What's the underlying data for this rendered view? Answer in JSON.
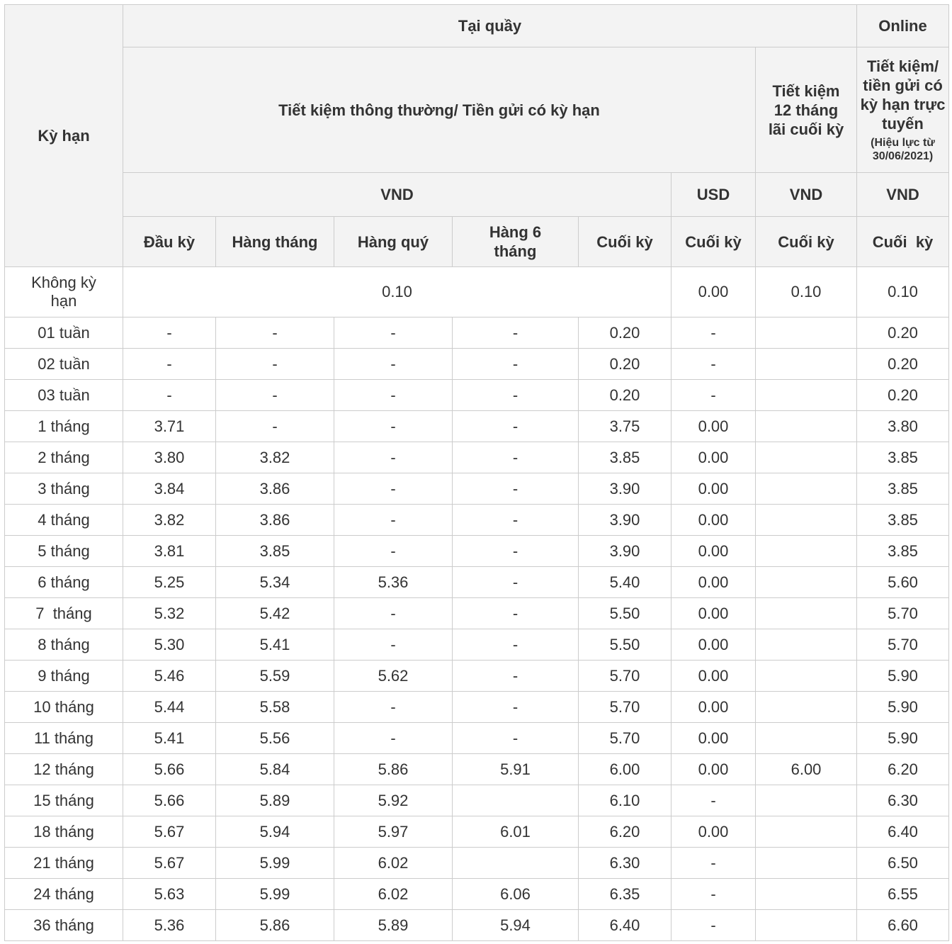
{
  "header": {
    "term_label": "Kỳ hạn",
    "counter_label": "Tại quầy",
    "online_label": "Online",
    "regular_savings_label": "Tiết kiệm thông thường/ Tiền gửi có kỳ hạn",
    "savings_12m_label": "Tiết kiệm 12 tháng lãi cuối kỳ",
    "online_savings_label": "Tiết kiệm/ tiền gửi có kỳ hạn trực tuyến",
    "online_effective_note": "(Hiệu lực từ 30/06/2021)",
    "currency": {
      "regular_vnd": "VND",
      "regular_usd": "USD",
      "savings_12m_vnd": "VND",
      "online_vnd": "VND"
    },
    "payment": {
      "beginning": "Đầu kỳ",
      "monthly": "Hàng tháng",
      "quarterly": "Hàng quý",
      "six_monthly": "Hàng 6 tháng",
      "end_vnd": "Cuối kỳ",
      "end_usd": "Cuối kỳ",
      "end_12m": "Cuối kỳ",
      "end_online": "Cuối  kỳ"
    }
  },
  "no_term_row": {
    "term": "Không kỳ hạn",
    "vnd": "0.10",
    "usd": "0.00",
    "savings_12m": "0.10",
    "online": "0.10"
  },
  "rows": [
    {
      "term": "01 tuần",
      "vals": [
        "-",
        "-",
        "-",
        "-",
        "0.20",
        "-",
        "",
        "0.20"
      ]
    },
    {
      "term": "02 tuần",
      "vals": [
        "-",
        "-",
        "-",
        "-",
        "0.20",
        "-",
        "",
        "0.20"
      ]
    },
    {
      "term": "03 tuần",
      "vals": [
        "-",
        "-",
        "-",
        "-",
        "0.20",
        "-",
        "",
        "0.20"
      ]
    },
    {
      "term": "1 tháng",
      "vals": [
        "3.71",
        "-",
        "-",
        "-",
        "3.75",
        "0.00",
        "",
        "3.80"
      ]
    },
    {
      "term": "2 tháng",
      "vals": [
        "3.80",
        "3.82",
        "-",
        "-",
        "3.85",
        "0.00",
        "",
        "3.85"
      ]
    },
    {
      "term": "3 tháng",
      "vals": [
        "3.84",
        "3.86",
        "-",
        "-",
        "3.90",
        "0.00",
        "",
        "3.85"
      ]
    },
    {
      "term": "4 tháng",
      "vals": [
        "3.82",
        "3.86",
        "-",
        "-",
        "3.90",
        "0.00",
        "",
        "3.85"
      ]
    },
    {
      "term": "5 tháng",
      "vals": [
        "3.81",
        "3.85",
        "-",
        "-",
        "3.90",
        "0.00",
        "",
        "3.85"
      ]
    },
    {
      "term": "6 tháng",
      "vals": [
        "5.25",
        "5.34",
        "5.36",
        "-",
        "5.40",
        "0.00",
        "",
        "5.60"
      ]
    },
    {
      "term": "7  tháng",
      "vals": [
        "5.32",
        "5.42",
        "-",
        "-",
        "5.50",
        "0.00",
        "",
        "5.70"
      ]
    },
    {
      "term": "8 tháng",
      "vals": [
        "5.30",
        "5.41",
        "-",
        "-",
        "5.50",
        "0.00",
        "",
        "5.70"
      ]
    },
    {
      "term": "9 tháng",
      "vals": [
        "5.46",
        "5.59",
        "5.62",
        "-",
        "5.70",
        "0.00",
        "",
        "5.90"
      ]
    },
    {
      "term": "10 tháng",
      "vals": [
        "5.44",
        "5.58",
        "-",
        "-",
        "5.70",
        "0.00",
        "",
        "5.90"
      ]
    },
    {
      "term": "11 tháng",
      "vals": [
        "5.41",
        "5.56",
        "-",
        "-",
        "5.70",
        "0.00",
        "",
        "5.90"
      ]
    },
    {
      "term": "12 tháng",
      "vals": [
        "5.66",
        "5.84",
        "5.86",
        "5.91",
        "6.00",
        "0.00",
        "6.00",
        "6.20"
      ]
    },
    {
      "term": "15 tháng",
      "vals": [
        "5.66",
        "5.89",
        "5.92",
        "",
        "6.10",
        "-",
        "",
        "6.30"
      ]
    },
    {
      "term": "18 tháng",
      "vals": [
        "5.67",
        "5.94",
        "5.97",
        "6.01",
        "6.20",
        "0.00",
        "",
        "6.40"
      ]
    },
    {
      "term": "21 tháng",
      "vals": [
        "5.67",
        "5.99",
        "6.02",
        "",
        "6.30",
        "-",
        "",
        "6.50"
      ]
    },
    {
      "term": "24 tháng",
      "vals": [
        "5.63",
        "5.99",
        "6.02",
        "6.06",
        "6.35",
        "-",
        "",
        "6.55"
      ]
    },
    {
      "term": "36 tháng",
      "vals": [
        "5.36",
        "5.86",
        "5.89",
        "5.94",
        "6.40",
        "-",
        "",
        "6.60"
      ]
    }
  ]
}
